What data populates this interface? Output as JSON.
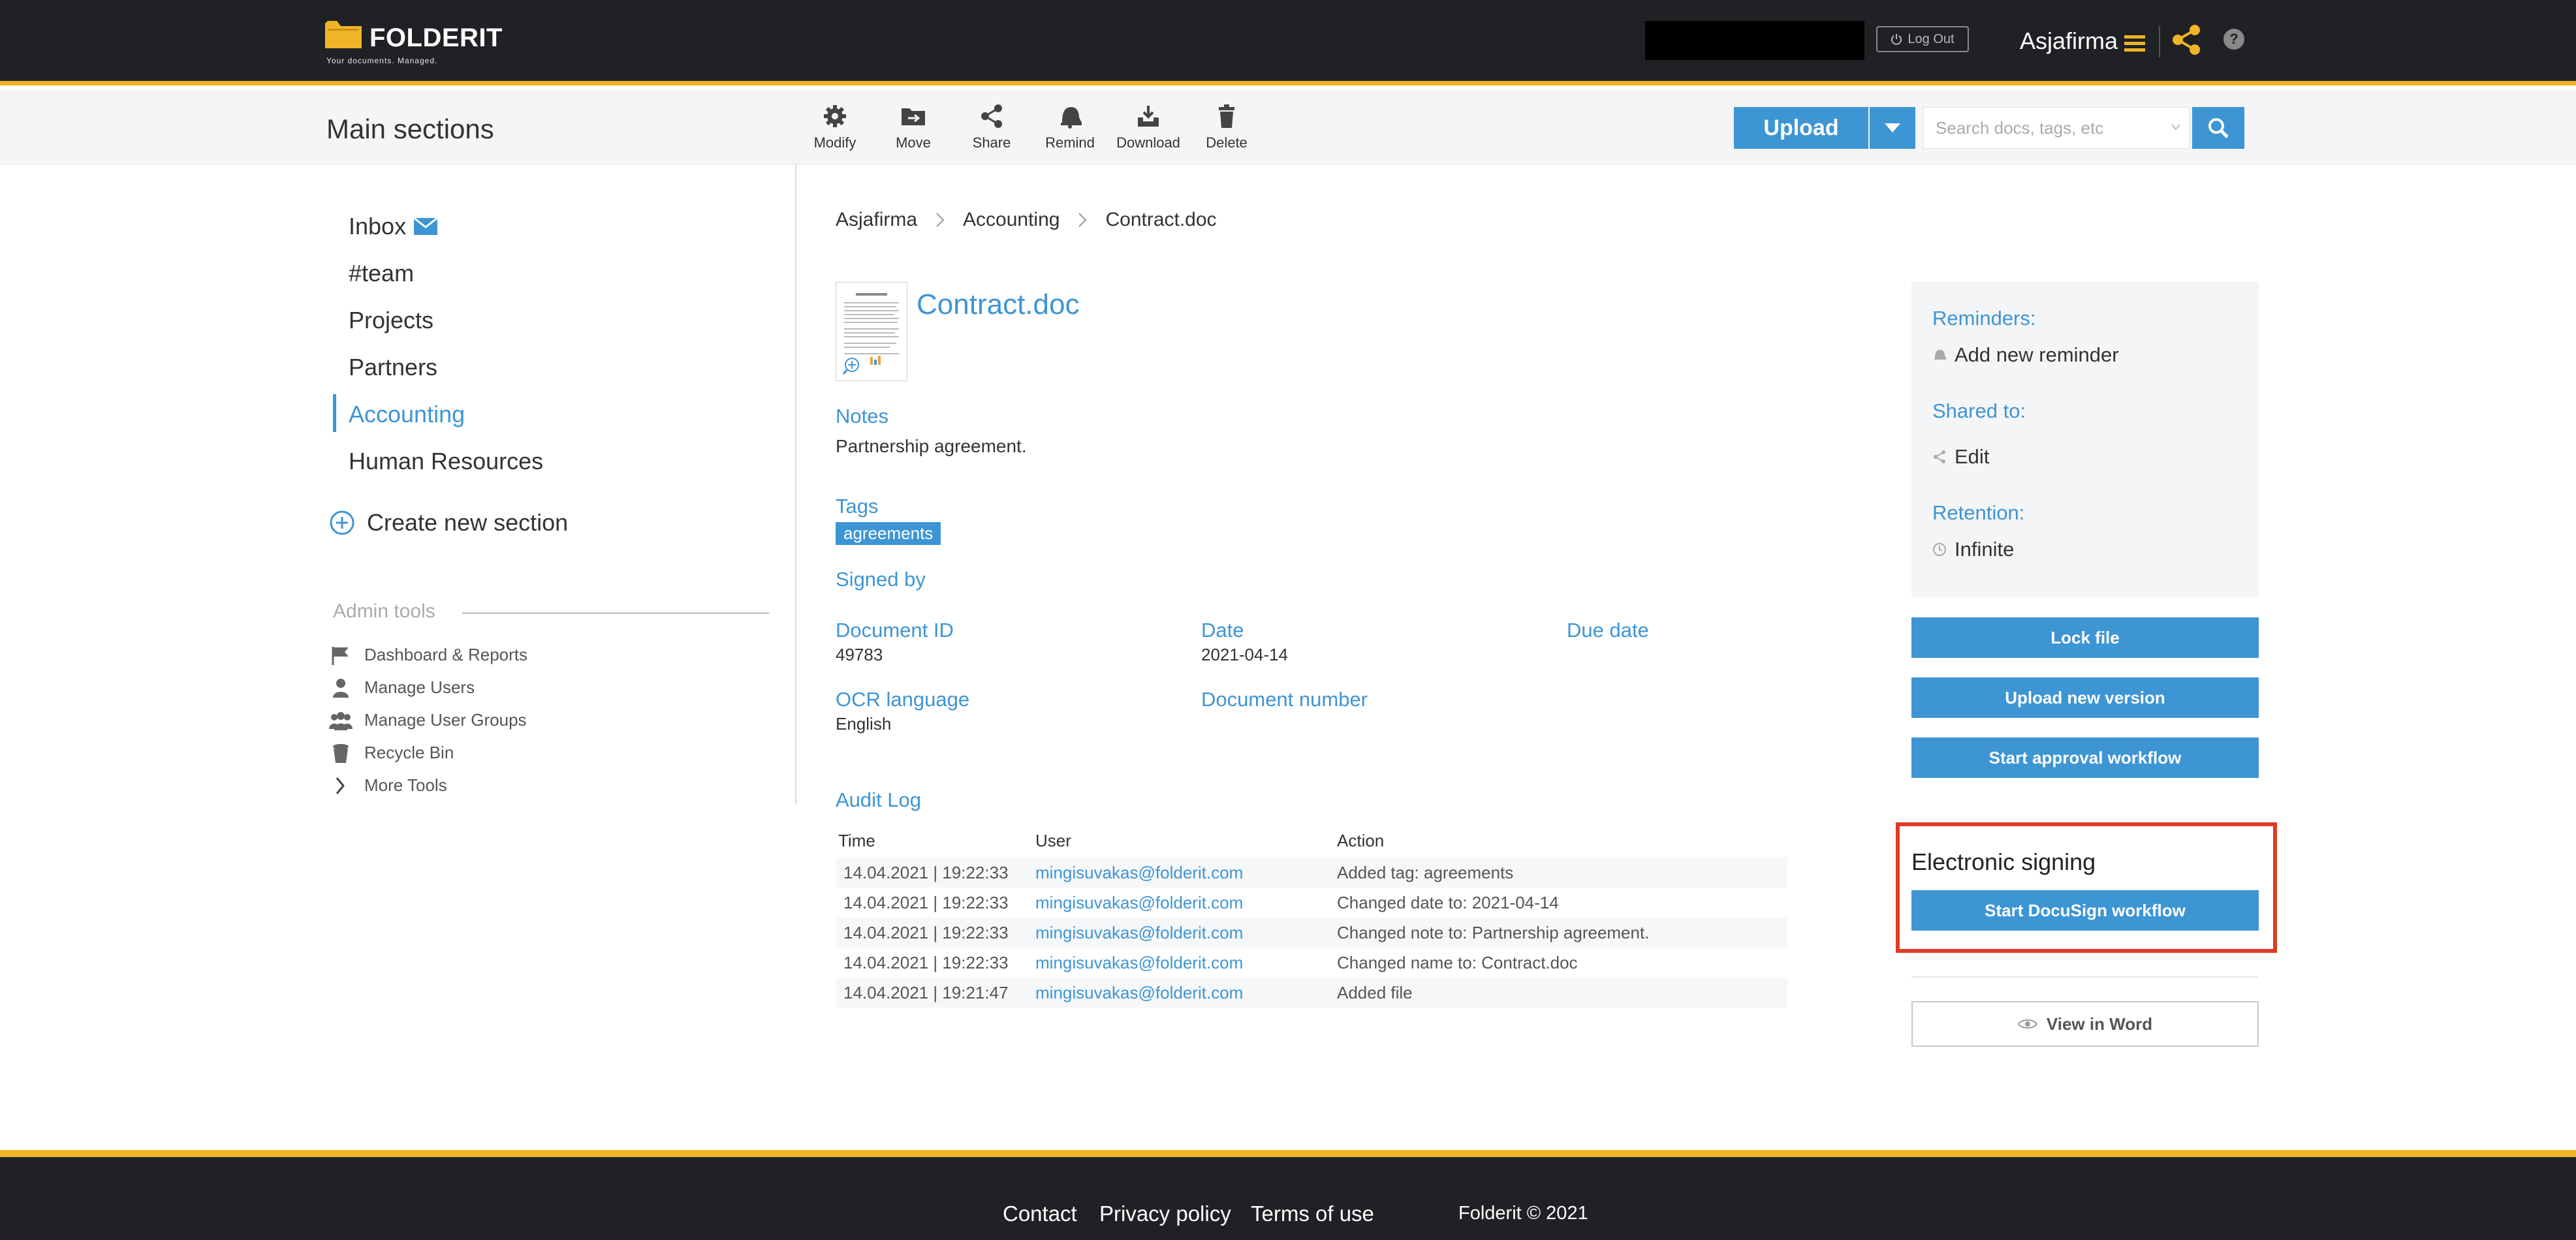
{
  "brand": {
    "name": "FOLDERIT",
    "tagline": "Your documents. Managed.",
    "accent": "#3d95d4",
    "header_bg": "#1f2124",
    "header_stripe": "#f0b429"
  },
  "header": {
    "logout_label": "Log Out",
    "company_name": "Asjafirma",
    "icons": [
      "folder-logo-icon",
      "power-icon",
      "hamburger-menu-icon",
      "share-icon",
      "help-icon"
    ],
    "help_label": "?"
  },
  "toolbar": {
    "section_title": "Main sections",
    "actions": [
      {
        "label": "Modify",
        "icon": "gear-icon"
      },
      {
        "label": "Move",
        "icon": "move-folder-icon"
      },
      {
        "label": "Share",
        "icon": "share-icon"
      },
      {
        "label": "Remind",
        "icon": "bell-icon"
      },
      {
        "label": "Download",
        "icon": "download-icon"
      },
      {
        "label": "Delete",
        "icon": "trash-icon"
      }
    ],
    "upload_label": "Upload",
    "search_placeholder": "Search docs, tags, etc"
  },
  "sidebar": {
    "items": [
      {
        "label": "Inbox",
        "icon": "envelope-icon"
      },
      {
        "label": "#team"
      },
      {
        "label": "Projects"
      },
      {
        "label": "Partners"
      },
      {
        "label": "Accounting",
        "active": true
      },
      {
        "label": "Human Resources"
      }
    ],
    "create_label": "Create new section",
    "admin_title": "Admin tools",
    "admin_items": [
      {
        "label": "Dashboard & Reports",
        "icon": "flag-icon"
      },
      {
        "label": "Manage Users",
        "icon": "user-icon"
      },
      {
        "label": "Manage User Groups",
        "icon": "users-group-icon"
      },
      {
        "label": "Recycle Bin",
        "icon": "bin-icon"
      },
      {
        "label": "More Tools",
        "icon": "chevron-right-icon"
      }
    ]
  },
  "breadcrumb": [
    "Asjafirma",
    "Accounting",
    "Contract.doc"
  ],
  "document": {
    "title": "Contract.doc",
    "notes_label": "Notes",
    "notes": "Partnership agreement.",
    "tags_label": "Tags",
    "tags": [
      "agreements"
    ],
    "signed_by_label": "Signed by",
    "doc_id_label": "Document ID",
    "doc_id": "49783",
    "date_label": "Date",
    "date": "2021-04-14",
    "due_date_label": "Due date",
    "ocr_label": "OCR language",
    "ocr": "English",
    "doc_number_label": "Document number"
  },
  "audit": {
    "title": "Audit Log",
    "columns": [
      "Time",
      "User",
      "Action"
    ],
    "rows": [
      {
        "time": "14.04.2021 | 19:22:33",
        "user": "mingisuvakas@folderit.com",
        "action": "Added tag: agreements"
      },
      {
        "time": "14.04.2021 | 19:22:33",
        "user": "mingisuvakas@folderit.com",
        "action": "Changed date to: 2021-04-14"
      },
      {
        "time": "14.04.2021 | 19:22:33",
        "user": "mingisuvakas@folderit.com",
        "action": "Changed note to: Partnership agreement."
      },
      {
        "time": "14.04.2021 | 19:22:33",
        "user": "mingisuvakas@folderit.com",
        "action": "Changed name to: Contract.doc"
      },
      {
        "time": "14.04.2021 | 19:21:47",
        "user": "mingisuvakas@folderit.com",
        "action": "Added file"
      }
    ]
  },
  "panel": {
    "reminders_label": "Reminders:",
    "add_reminder": "Add new reminder",
    "shared_label": "Shared to:",
    "edit": "Edit",
    "retention_label": "Retention:",
    "retention": "Infinite",
    "lock_file": "Lock file",
    "upload_version": "Upload new version",
    "approval": "Start approval workflow",
    "esign_title": "Electronic signing",
    "docusign": "Start DocuSign workflow",
    "view_word": "View in Word",
    "highlight_color": "#e03a26"
  },
  "footer": {
    "contact": "Contact",
    "privacy": "Privacy policy",
    "terms": "Terms of use",
    "copyright": "Folderit © 2021"
  }
}
